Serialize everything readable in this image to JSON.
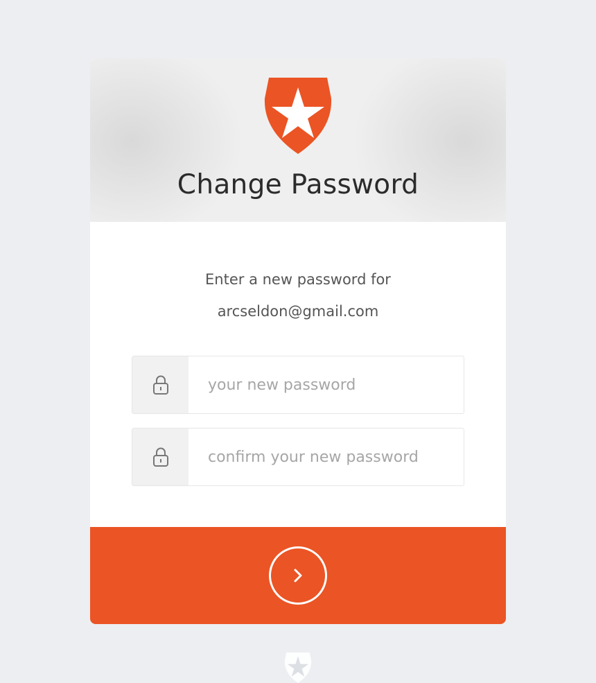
{
  "brand": {
    "accent_color": "#eb5424",
    "logo": "auth0-shield-star-logo"
  },
  "header": {
    "title": "Change Password"
  },
  "prompt": {
    "line1": "Enter a new password for",
    "email": "arcseldon@gmail.com"
  },
  "fields": [
    {
      "icon": "lock-icon",
      "value": "",
      "placeholder": "your new password"
    },
    {
      "icon": "lock-icon",
      "value": "",
      "placeholder": "confirm your new password"
    }
  ],
  "submit": {
    "icon": "chevron-right-icon"
  },
  "footer": {
    "logo": "auth0-shield-star-logo"
  }
}
